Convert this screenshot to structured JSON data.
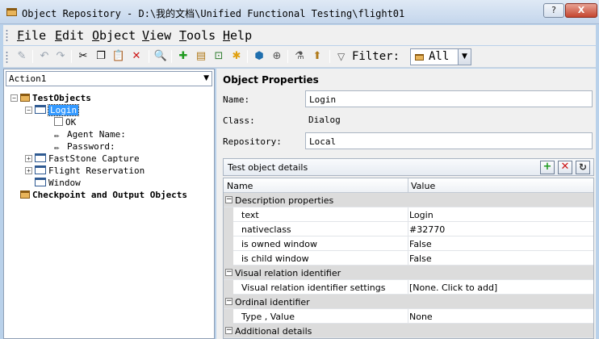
{
  "window": {
    "title": "Object Repository - D:\\我的文档\\Unified Functional Testing\\flight01",
    "help_label": "?",
    "close_label": "X"
  },
  "menu": [
    "File",
    "Edit",
    "Object",
    "View",
    "Tools",
    "Help"
  ],
  "toolbar": {
    "filter_label": "Filter:",
    "filter_value": "All"
  },
  "action_selector": {
    "value": "Action1"
  },
  "tree": {
    "root_label": "TestObjects",
    "selected_label": "Login",
    "children_of_login": [
      "OK",
      "Agent Name:",
      "Password:"
    ],
    "other_windows": [
      "FastStone Capture",
      "Flight Reservation",
      "Window"
    ],
    "checkpoint_label": "Checkpoint and Output Objects"
  },
  "properties": {
    "title": "Object Properties",
    "name_label": "Name:",
    "name_value": "Login",
    "class_label": "Class:",
    "class_value": "Dialog",
    "repository_label": "Repository:",
    "repository_value": "Local"
  },
  "details": {
    "title": "Test object details",
    "col_name": "Name",
    "col_value": "Value",
    "rows": [
      {
        "category": "Description properties"
      },
      {
        "name": "text",
        "value": "Login"
      },
      {
        "name": "nativeclass",
        "value": "#32770"
      },
      {
        "name": "is owned window",
        "value": "False"
      },
      {
        "name": "is child window",
        "value": "False"
      },
      {
        "category": "Visual relation identifier"
      },
      {
        "name": "Visual relation identifier settings",
        "value": "[None. Click to add]"
      },
      {
        "category": "Ordinal identifier"
      },
      {
        "name": "Type , Value",
        "value": "None"
      },
      {
        "category": "Additional details"
      }
    ]
  },
  "colors": {
    "selection": "#3399ff",
    "category_row": "#dcdcdc",
    "add": "#1f9a1f",
    "remove": "#cc1515"
  }
}
